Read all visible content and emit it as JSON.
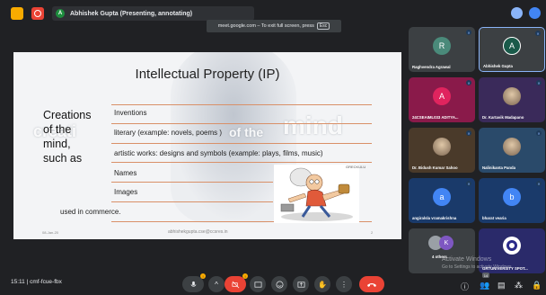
{
  "topbar": {
    "presenter_initial": "A",
    "presenting_text": "Abhishek Gupta (Presenting, annotating)",
    "fullscreen_notice": "meet.google.com – To exit full screen, press",
    "fullscreen_key": "Esc"
  },
  "slide": {
    "title": "Intellectual Property (IP)",
    "creations_lines": [
      "Creations",
      "of the",
      "mind,",
      "such as"
    ],
    "ghost_words": [
      "creati",
      "of the",
      "mind"
    ],
    "items": [
      "Inventions",
      "literary (example: novels, poems )",
      "artistic works: designs and symbols (example: plays, films, music)",
      "Names",
      "Images"
    ],
    "commerce": "used in commerce.",
    "footer_left": "08-Jan-20",
    "footer_center": "abhishekgupta.cse@ccsres.in",
    "footer_right": "2",
    "cartoon_credit": "GRECKULU"
  },
  "participants": [
    {
      "name": "Raghvendra Agrawal",
      "initial": "R",
      "color": "#4a8a7a"
    },
    {
      "name": "Abhishek Gupta",
      "initial": "A",
      "color": "#1a5a4a"
    },
    {
      "name": "24CSEAIML033 ADITYA...",
      "initial": "A",
      "color": "#e0245e"
    },
    {
      "name": "Dr. Kartavik Madapano",
      "initial": "",
      "color": "#5a4a8a"
    },
    {
      "name": "Dr. Bidush Kumar Sahoo",
      "initial": "",
      "color": "#5a4a3a"
    },
    {
      "name": "Nalinikanta Panda",
      "initial": "",
      "color": "#4a6a8a"
    },
    {
      "name": "angiralsla vramakrishna",
      "initial": "a",
      "color": "#4285f4"
    },
    {
      "name": "bharat vearia",
      "initial": "b",
      "color": "#4285f4"
    },
    {
      "name": "4 others",
      "initial": "",
      "color": "#3c4043"
    },
    {
      "name": "GRTUNIVERSITY SPOT...",
      "initial": "",
      "color": "#3c4043"
    }
  ],
  "others": {
    "avatar_initial": "K"
  },
  "watermark": {
    "line1": "Activate Windows",
    "line2": "Go to Settings to activate Windows."
  },
  "bottombar": {
    "time": "15:11",
    "separator": "|",
    "meeting_code": "cmf-fcue-fbx",
    "people_count": "14"
  },
  "colors": {
    "accent": "#8ab4f8",
    "end_call": "#ea4335",
    "bg": "#202124"
  }
}
